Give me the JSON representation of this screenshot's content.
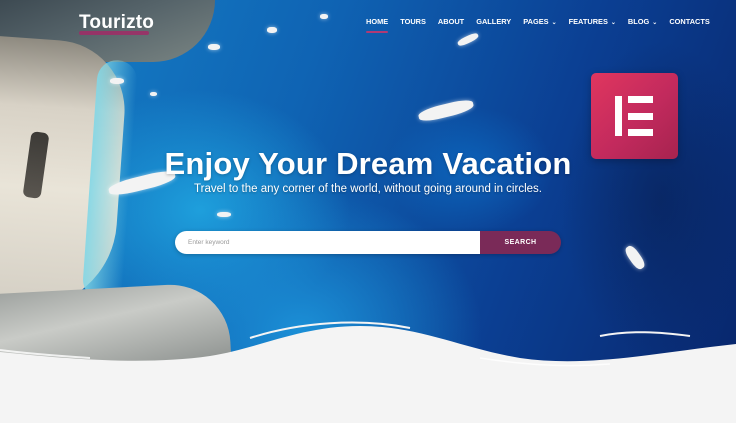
{
  "brand": {
    "name": "Tourizto",
    "accent": "#a02b66"
  },
  "nav": {
    "items": [
      {
        "label": "HOME",
        "active": true,
        "dropdown": false
      },
      {
        "label": "TOURS",
        "active": false,
        "dropdown": false
      },
      {
        "label": "ABOUT",
        "active": false,
        "dropdown": false
      },
      {
        "label": "GALLERY",
        "active": false,
        "dropdown": false
      },
      {
        "label": "PAGES",
        "active": false,
        "dropdown": true
      },
      {
        "label": "FEATURES",
        "active": false,
        "dropdown": true
      },
      {
        "label": "BLOG",
        "active": false,
        "dropdown": true
      },
      {
        "label": "CONTACTS",
        "active": false,
        "dropdown": false
      }
    ],
    "dropdown_glyph": "⌄"
  },
  "hero": {
    "title": "Enjoy Your Dream Vacation",
    "subtitle": "Travel to the any corner of the world, without going around in circles."
  },
  "search": {
    "placeholder": "Enter keyword",
    "value": "",
    "button_label": "SEARCH",
    "button_color": "#7a2a58"
  },
  "badge": {
    "icon": "elementor-logo-icon",
    "color": "#d3305f"
  }
}
